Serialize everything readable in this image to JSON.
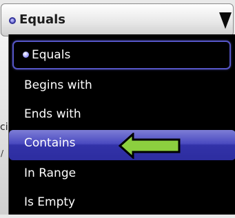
{
  "select": {
    "selected_label": "Equals"
  },
  "dropdown": {
    "items": [
      {
        "label": "Equals",
        "state": "selected"
      },
      {
        "label": "Begins with",
        "state": "normal"
      },
      {
        "label": "Ends with",
        "state": "normal"
      },
      {
        "label": "Contains",
        "state": "highlighted"
      },
      {
        "label": "In Range",
        "state": "normal"
      },
      {
        "label": "Is Empty",
        "state": "normal"
      }
    ]
  },
  "background": {
    "edge_text_1": "ci",
    "edge_text_2": "/"
  },
  "colors": {
    "accent": "#4a4ac0",
    "callout_fill": "#8ccf3f",
    "callout_stroke": "#000000",
    "list_background": "#000000"
  }
}
